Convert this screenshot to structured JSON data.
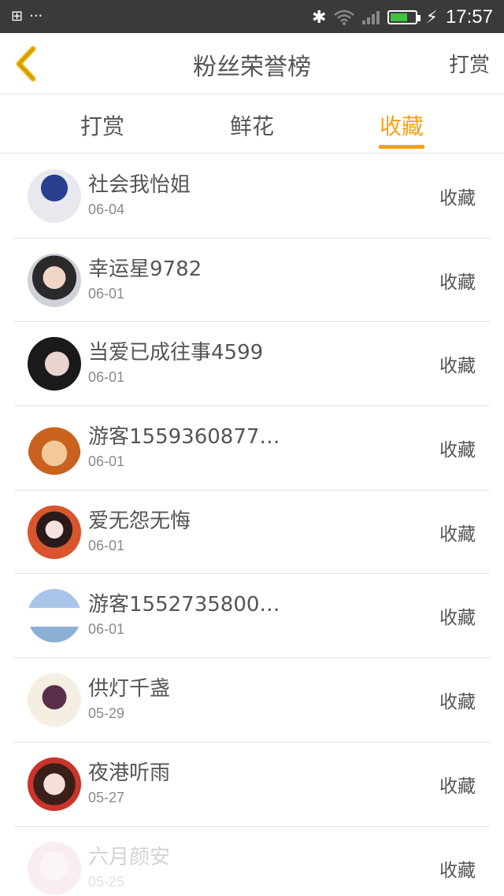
{
  "status_bar": {
    "time": "17:57"
  },
  "header": {
    "title": "粉丝荣誉榜",
    "action": "打赏"
  },
  "tabs": [
    {
      "label": "打赏",
      "active": false
    },
    {
      "label": "鲜花",
      "active": false
    },
    {
      "label": "收藏",
      "active": true
    }
  ],
  "colors": {
    "accent": "#f5a11a",
    "text": "#555555",
    "subtext": "#8a8a8a",
    "status_bar": "#3a3a3a"
  },
  "rows": [
    {
      "name": "社会我怡姐",
      "date": "06-04",
      "action": "收藏"
    },
    {
      "name": "幸运星9782",
      "date": "06-01",
      "action": "收藏"
    },
    {
      "name": "当爱已成往事4599",
      "date": "06-01",
      "action": "收藏"
    },
    {
      "name": "游客1559360877…",
      "date": "06-01",
      "action": "收藏"
    },
    {
      "name": "爱无怨无悔",
      "date": "06-01",
      "action": "收藏"
    },
    {
      "name": "游客1552735800…",
      "date": "06-01",
      "action": "收藏"
    },
    {
      "name": "供灯千盏",
      "date": "05-29",
      "action": "收藏"
    },
    {
      "name": "夜港听雨",
      "date": "05-27",
      "action": "收藏"
    },
    {
      "name": "六月颜安",
      "date": "05-25",
      "action": "收藏"
    }
  ]
}
